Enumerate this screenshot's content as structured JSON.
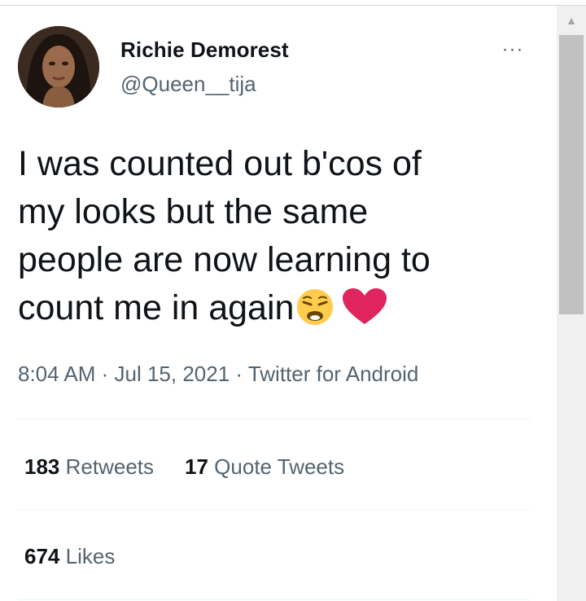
{
  "author": {
    "name": "Richie Demorest",
    "handle": "@Queen__tija"
  },
  "more_menu": {
    "label": "···"
  },
  "tweet": {
    "lines": [
      "I was counted out b'cos of",
      "my looks but the same",
      "people are now learning to",
      "count me in again"
    ],
    "emojis": [
      "weary-face-icon",
      "red-heart-icon"
    ]
  },
  "meta": {
    "time": "8:04 AM",
    "sep1": " · ",
    "date": "Jul 15, 2021",
    "sep2": " · ",
    "source": "Twitter for Android"
  },
  "stats": {
    "retweets_count": "183",
    "retweets_label": "Retweets",
    "quotes_count": "17",
    "quotes_label": "Quote Tweets",
    "likes_count": "674",
    "likes_label": "Likes"
  },
  "colors": {
    "text_primary": "#0f1419",
    "text_secondary": "#536471",
    "divider": "#eff3f4",
    "heart": "#e0245e",
    "emoji_face": "#ffcc4d"
  }
}
